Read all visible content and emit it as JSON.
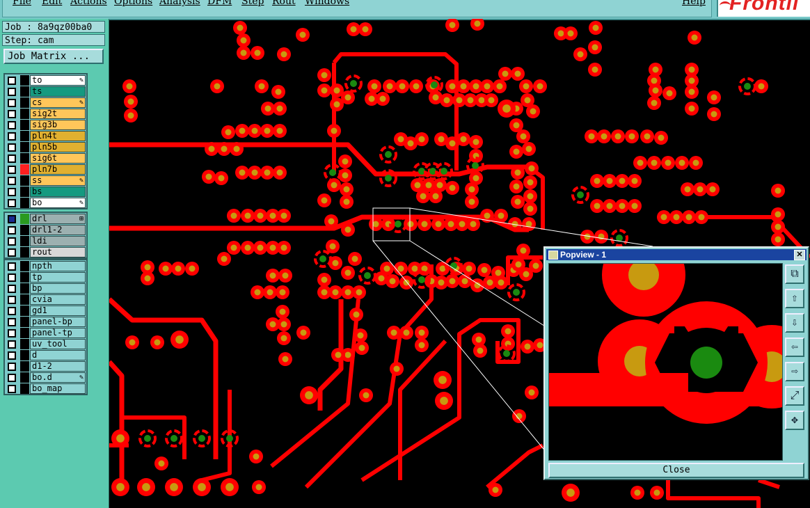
{
  "menubar": {
    "items": [
      "File",
      "Edit",
      "Actions",
      "Options",
      "Analysis",
      "DFM",
      "Step",
      "Rout",
      "Windows"
    ],
    "help": "Help",
    "logo": "Frontli"
  },
  "job": {
    "job_text": "Job : 8a9qz00ba0",
    "step_text": "Step: cam",
    "matrix_button": "Job Matrix ..."
  },
  "layer_groups": [
    {
      "layers": [
        {
          "name": "to",
          "bg": "#ffffff",
          "swatch": "#000000",
          "flag": "✎"
        },
        {
          "name": "ts",
          "bg": "#159a80",
          "swatch": "#000000",
          "flag": ""
        },
        {
          "name": "cs",
          "bg": "#ffc65a",
          "swatch": "#000000",
          "flag": "✎"
        },
        {
          "name": "sig2t",
          "bg": "#ffc65a",
          "swatch": "#000000",
          "flag": ""
        },
        {
          "name": "sig3b",
          "bg": "#ffc65a",
          "swatch": "#000000",
          "flag": ""
        },
        {
          "name": "pln4t",
          "bg": "#e0b030",
          "swatch": "#000000",
          "flag": ""
        },
        {
          "name": "pln5b",
          "bg": "#e0b030",
          "swatch": "#000000",
          "flag": ""
        },
        {
          "name": "sig6t",
          "bg": "#ffc65a",
          "swatch": "#000000",
          "flag": ""
        },
        {
          "name": "pln7b",
          "bg": "#e0b030",
          "swatch": "#ff2020",
          "flag": ""
        },
        {
          "name": "ss",
          "bg": "#ffc65a",
          "swatch": "#000000",
          "flag": "✎"
        },
        {
          "name": "bs",
          "bg": "#159a80",
          "swatch": "#000000",
          "flag": ""
        },
        {
          "name": "bo",
          "bg": "#ffffff",
          "swatch": "#000000",
          "flag": "✎"
        }
      ]
    },
    {
      "layers": [
        {
          "name": "drl",
          "bg": "#9cb0b0",
          "swatch": "#2a9a20",
          "flag": "⊞"
        },
        {
          "name": "drl1-2",
          "bg": "#9cb0b0",
          "swatch": "#000000",
          "flag": ""
        },
        {
          "name": "ldi",
          "bg": "#9cb0b0",
          "swatch": "#000000",
          "flag": ""
        },
        {
          "name": "rout",
          "bg": "#d8d8d8",
          "swatch": "#000000",
          "flag": ""
        }
      ]
    },
    {
      "layers": [
        {
          "name": "npth",
          "bg": "#8fd3d3",
          "swatch": "#000000",
          "flag": ""
        },
        {
          "name": "tp",
          "bg": "#8fd3d3",
          "swatch": "#000000",
          "flag": ""
        },
        {
          "name": "bp",
          "bg": "#8fd3d3",
          "swatch": "#000000",
          "flag": ""
        },
        {
          "name": "cvia",
          "bg": "#8fd3d3",
          "swatch": "#000000",
          "flag": ""
        },
        {
          "name": "gd1",
          "bg": "#8fd3d3",
          "swatch": "#000000",
          "flag": ""
        },
        {
          "name": "panel-bp",
          "bg": "#8fd3d3",
          "swatch": "#000000",
          "flag": ""
        },
        {
          "name": "panel-tp",
          "bg": "#8fd3d3",
          "swatch": "#000000",
          "flag": ""
        },
        {
          "name": "uv_tool",
          "bg": "#8fd3d3",
          "swatch": "#000000",
          "flag": ""
        },
        {
          "name": "d",
          "bg": "#8fd3d3",
          "swatch": "#000000",
          "flag": ""
        },
        {
          "name": "d1-2",
          "bg": "#8fd3d3",
          "swatch": "#000000",
          "flag": ""
        },
        {
          "name": "bo.d",
          "bg": "#8fd3d3",
          "swatch": "#000000",
          "flag": "✎"
        },
        {
          "name": "bo_map",
          "bg": "#8fd3d3",
          "swatch": "#000000",
          "flag": ""
        }
      ]
    }
  ],
  "popview": {
    "title": "Popview - 1",
    "close_label": "Close",
    "x_label": "✕",
    "tools": [
      "⧉",
      "⇧",
      "⇩",
      "⇦",
      "⇨",
      "⤢",
      "✥"
    ]
  },
  "colors": {
    "trace": "#ff0000",
    "pad_center": "#c89a10",
    "drill": "#1a8a10",
    "background": "#000000"
  }
}
